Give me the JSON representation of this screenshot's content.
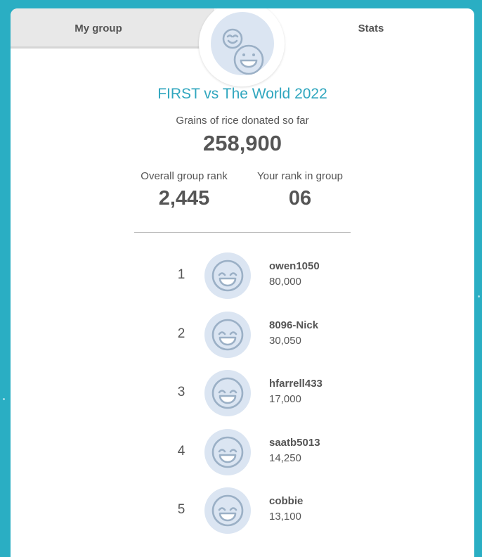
{
  "tabs": {
    "my_group": "My group",
    "stats": "Stats"
  },
  "group": {
    "badge_icon": "grinning-faces-icon",
    "title": "FIRST vs The World 2022",
    "donated_label": "Grains of rice donated so far",
    "donated_value": "258,900",
    "overall_rank_label": "Overall group rank",
    "overall_rank_value": "2,445",
    "your_rank_label": "Your rank in group",
    "your_rank_value": "06"
  },
  "leaderboard": [
    {
      "rank": "1",
      "name": "owen1050",
      "grains": "80,000"
    },
    {
      "rank": "2",
      "name": "8096-Nick",
      "grains": "30,050"
    },
    {
      "rank": "3",
      "name": "hfarrell433",
      "grains": "17,000"
    },
    {
      "rank": "4",
      "name": "saatb5013",
      "grains": "14,250"
    },
    {
      "rank": "5",
      "name": "cobbie",
      "grains": "13,100"
    }
  ],
  "colors": {
    "background": "#2aaec3",
    "title_accent": "#2fa6be",
    "avatar_fill": "#dbe5f2",
    "face_stroke": "#9bb0c6",
    "text": "#555555"
  }
}
